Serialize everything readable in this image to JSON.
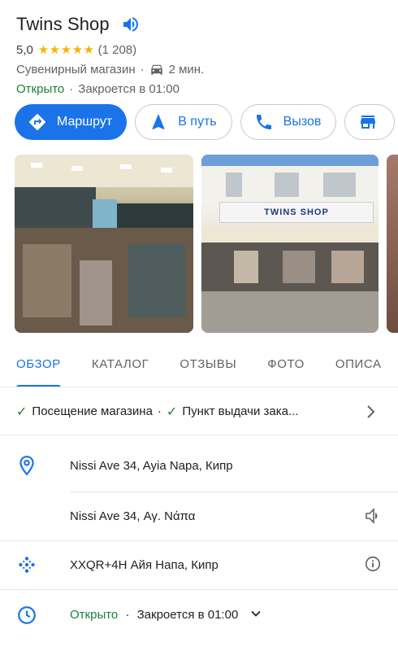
{
  "place": {
    "name": "Twins Shop",
    "rating": "5,0",
    "stars": "★★★★★",
    "review_count": "(1 208)",
    "category": "Сувенирный магазин",
    "separator": "·",
    "drive_time": "2 мин.",
    "status_open": "Открыто",
    "status_close": "Закроется в 01:00"
  },
  "actions": [
    {
      "label": "Маршрут",
      "icon": "directions-icon"
    },
    {
      "label": "В путь",
      "icon": "navigation-icon"
    },
    {
      "label": "Вызов",
      "icon": "phone-icon"
    },
    {
      "label": "",
      "icon": "store-icon"
    }
  ],
  "photos": {
    "sign_text": "TWINS SHOP"
  },
  "tabs": [
    "ОБЗОР",
    "КАТАЛОГ",
    "ОТЗЫВЫ",
    "ФОТО",
    "ОПИСА"
  ],
  "services": {
    "item1": "Посещение магазина",
    "item2": "Пункт выдачи зака...",
    "check": "✓",
    "separator": "·"
  },
  "details": {
    "address": "Nissi Ave 34, Ayia Napa, Кипр",
    "address_local": "Nissi Ave 34, Αγ. Νάπα",
    "plus_code": "XXQR+4H Айя Напа, Кипр",
    "hours_open": "Открыто",
    "hours_close": "Закроется в 01:00",
    "hours_separator": "·"
  },
  "colors": {
    "accent": "#1a73e8",
    "open_green": "#188038",
    "star": "#f4b400"
  }
}
